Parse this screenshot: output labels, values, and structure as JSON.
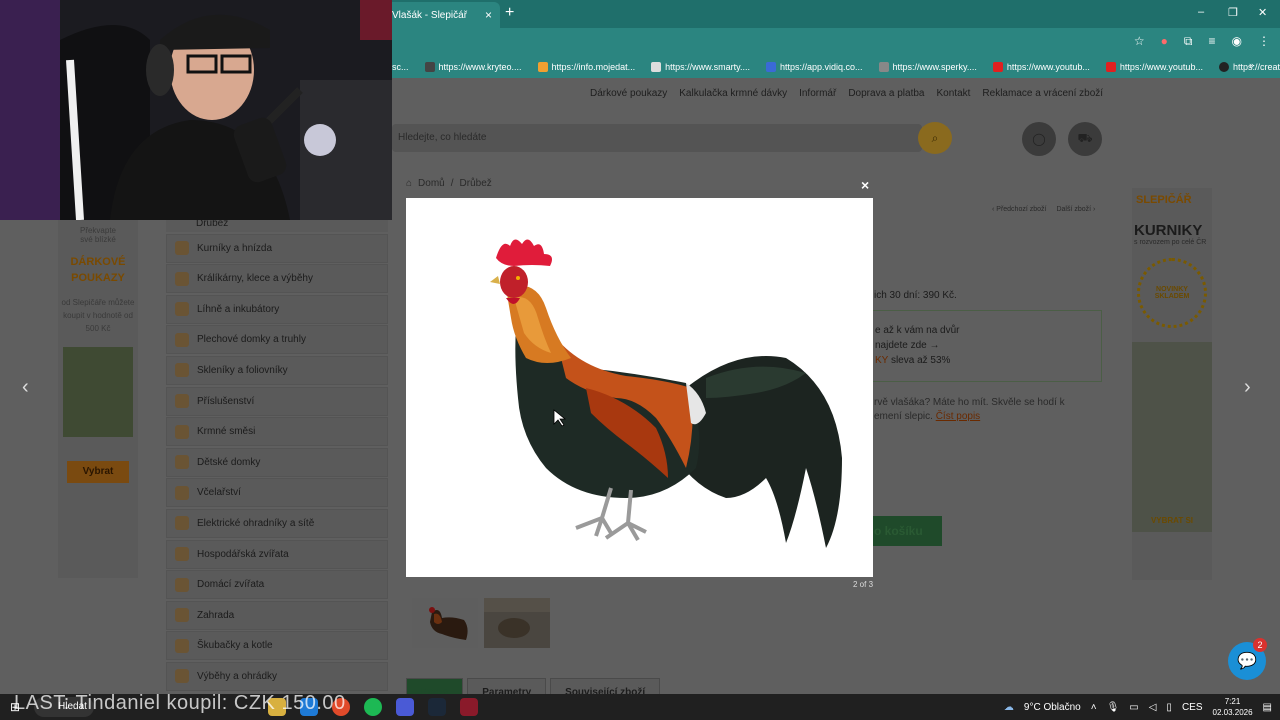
{
  "browser": {
    "tab_title": "Vlašák - Slepičář",
    "tab_close": "×",
    "new_tab": "+",
    "bookmarks": [
      "https://www.kryteo....",
      "https://info.mojedat...",
      "https://www.smarty....",
      "https://app.vidiq.co...",
      "https://www.sperky....",
      "https://www.youtub...",
      "https://www.youtub...",
      "https://creatorsprog..."
    ],
    "bookmark_partial": "sc...",
    "bookmarks_more": "»",
    "window_controls": [
      "–",
      "❐",
      "✕"
    ]
  },
  "site": {
    "top_nav": [
      "Dárkové poukazy",
      "Kalkulačka krmné dávky",
      "Informář",
      "Doprava a platba",
      "Kontakt",
      "Reklamace a vrácení zboží"
    ],
    "search_placeholder": "Hledejte, co hledáte",
    "breadcrumb": [
      "Domů",
      "/",
      "Drůbež"
    ],
    "prev_product": "‹ Předchozí zboží",
    "next_product": "Další zboží ›",
    "left_banner": {
      "line1": "Překvapte",
      "line2": "své blízké",
      "big": "DÁRKOVÉ POUKAZY",
      "text": "od Slepičáře můžete koupit v hodnotě od 500 Kč",
      "buy": "Vybrat"
    },
    "categories": [
      "Drůbež",
      "Kurníky a hnízda",
      "Králíkárny, klece a výběhy",
      "Líhně a inkubátory",
      "Plechové domky a truhly",
      "Skleníky a foliovníky",
      "Příslušenství",
      "Krmné směsi",
      "Dětské domky",
      "Včelařství",
      "Elektrické ohradníky a sítě",
      "Hospodářská zvířata",
      "Domácí zvířata",
      "Zahrada",
      "Škubačky a kotle",
      "Výběhy a ohrádky"
    ],
    "right_banner": {
      "brand": "SLEPIČÁŘ",
      "title": "KURNIKY",
      "subtitle": "s rozvozem po celé ČR",
      "badge_line1": "NOVINKY",
      "badge_line2": "SKLADEM",
      "buy": "VYBRAT SI"
    },
    "price_info": "ich 30 dní: 390 Kč.",
    "info_box": {
      "line1": "e až k vám na dvůr",
      "line2": "najdete zde →",
      "line3_hl": "KY",
      "line3_rest": " sleva až 53%"
    },
    "description": "rvě vlašáka? Máte ho mít. Skvěle se hodí k",
    "description2": "emení slepic.",
    "description_link": "Číst popis",
    "cart_button": "o košíku",
    "bottom_tabs": [
      "Popis",
      "Parametry",
      "Související zboží"
    ]
  },
  "lightbox": {
    "close": "×",
    "counter": "2 of 3",
    "prev": "‹",
    "next": "›"
  },
  "chat": {
    "badge": "2"
  },
  "taskbar": {
    "search": "Hledat",
    "overlay_text": "LAST: Tindaniel koupil: CZK 150.00",
    "weather": "9°C  Oblačno",
    "language": "CES",
    "time": "7:21",
    "date": "02.03.2026"
  }
}
